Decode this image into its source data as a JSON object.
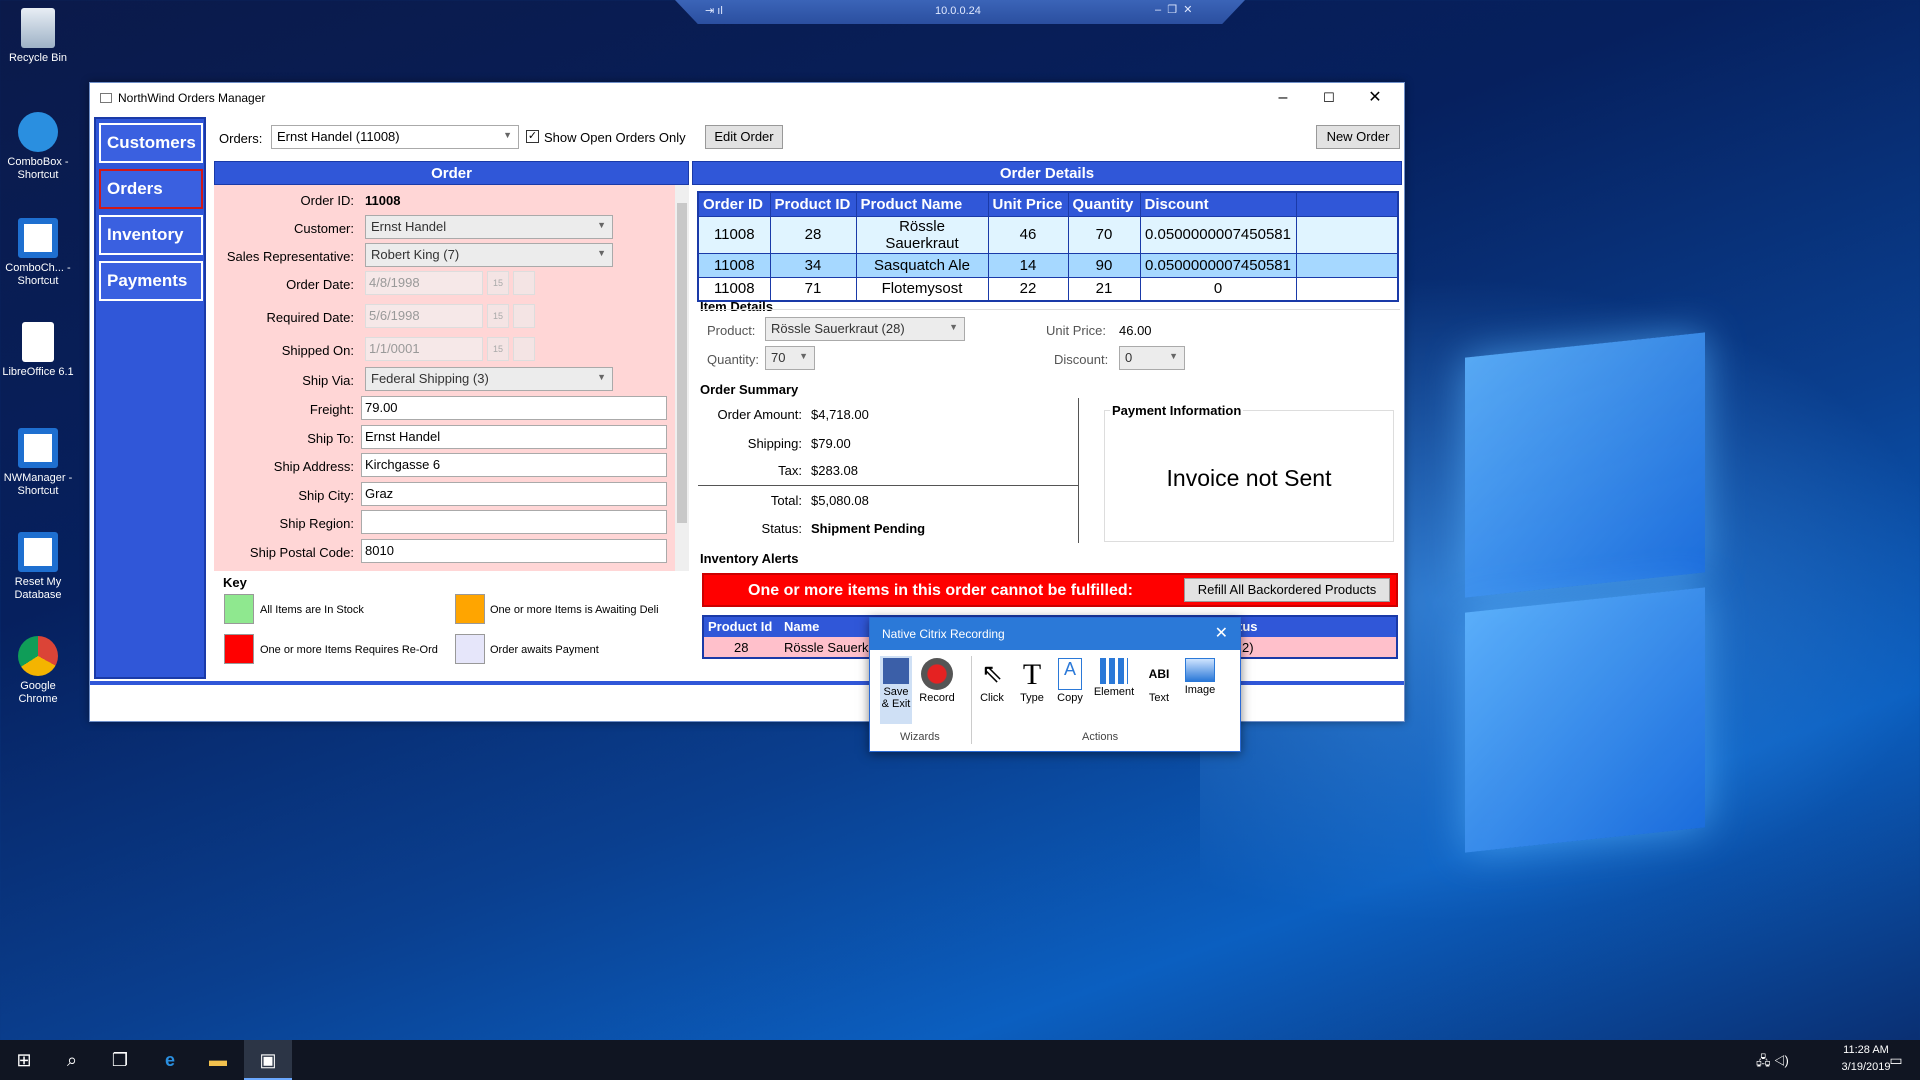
{
  "citrix_bar": {
    "address": "10.0.0.24"
  },
  "desktop": {
    "icons": [
      {
        "label": "Recycle Bin"
      },
      {
        "label": "ComboBox - Shortcut"
      },
      {
        "label": "ComboCh... - Shortcut"
      },
      {
        "label": "LibreOffice 6.1"
      },
      {
        "label": "NWManager - Shortcut"
      },
      {
        "label": "Reset My Database"
      },
      {
        "label": "Google Chrome"
      }
    ]
  },
  "window": {
    "title": "NorthWind Orders Manager"
  },
  "nav": {
    "items": [
      "Customers",
      "Orders",
      "Inventory",
      "Payments"
    ]
  },
  "toolbar": {
    "orders_label": "Orders:",
    "orders_value": "Ernst Handel (11008)",
    "show_open_label": "Show Open Orders Only",
    "edit_order": "Edit Order",
    "new_order": "New Order"
  },
  "order": {
    "header": "Order",
    "labels": {
      "id": "Order ID:",
      "customer": "Customer:",
      "sales_rep": "Sales Representative:",
      "order_date": "Order Date:",
      "required_date": "Required Date:",
      "shipped_on": "Shipped On:",
      "ship_via": "Ship Via:",
      "freight": "Freight:",
      "ship_to": "Ship To:",
      "ship_address": "Ship Address:",
      "ship_city": "Ship City:",
      "ship_region": "Ship Region:",
      "ship_postal": "Ship Postal Code:"
    },
    "values": {
      "id": "11008",
      "customer": "Ernst Handel",
      "sales_rep": "Robert King (7)",
      "order_date": "4/8/1998",
      "required_date": "5/6/1998",
      "shipped_on": "1/1/0001",
      "ship_via": "Federal Shipping (3)",
      "freight": "79.00",
      "ship_to": "Ernst Handel",
      "ship_address": "Kirchgasse 6",
      "ship_city": "Graz",
      "ship_region": "",
      "ship_postal": "8010"
    }
  },
  "key": {
    "title": "Key",
    "items": [
      {
        "text": "All Items are In Stock",
        "color": "#8fe88f"
      },
      {
        "text": "One or more Items is Awaiting Deli",
        "color": "#ffa500"
      },
      {
        "text": "One or more Items Requires Re-Ord",
        "color": "#ff0000"
      },
      {
        "text": "Order awaits Payment",
        "color": "#e6e6fa"
      }
    ]
  },
  "details": {
    "header": "Order Details",
    "columns": [
      "Order ID",
      "Product ID",
      "Product Name",
      "Unit Price",
      "Quantity",
      "Discount"
    ],
    "rows": [
      [
        "11008",
        "28",
        "Rössle Sauerkraut",
        "46",
        "70",
        "0.0500000007450581"
      ],
      [
        "11008",
        "34",
        "Sasquatch Ale",
        "14",
        "90",
        "0.0500000007450581"
      ],
      [
        "11008",
        "71",
        "Flotemysost",
        "22",
        "21",
        "0"
      ]
    ]
  },
  "item_details": {
    "title": "Item Details",
    "product_label": "Product:",
    "product_value": "Rössle Sauerkraut (28)",
    "quantity_label": "Quantity:",
    "quantity_value": "70",
    "unit_price_label": "Unit Price:",
    "unit_price_value": "46.00",
    "discount_label": "Discount:",
    "discount_value": "0"
  },
  "summary": {
    "title": "Order Summary",
    "amount_label": "Order Amount:",
    "amount": "$4,718.00",
    "shipping_label": "Shipping:",
    "shipping": "$79.00",
    "tax_label": "Tax:",
    "tax": "$283.08",
    "total_label": "Total:",
    "total": "$5,080.08",
    "status_label": "Status:",
    "status": "Shipment Pending"
  },
  "payment": {
    "title": "Payment Information",
    "text": "Invoice not Sent"
  },
  "alerts": {
    "title": "Inventory Alerts",
    "message": "One or more items in this order cannot be fulfilled:",
    "refill": "Refill All Backordered Products",
    "columns": [
      "Product Id",
      "Name",
      "tus"
    ],
    "row": [
      "28",
      "Rössle Sauerk",
      "2)"
    ]
  },
  "recording": {
    "title": "Native Citrix Recording",
    "items": [
      "Save & Exit",
      "Record",
      "Click",
      "Type",
      "Copy",
      "Element",
      "Text",
      "Image"
    ],
    "groups": [
      "Wizards",
      "Actions"
    ]
  },
  "taskbar": {
    "time": "11:28 AM",
    "date": "3/19/2019"
  }
}
